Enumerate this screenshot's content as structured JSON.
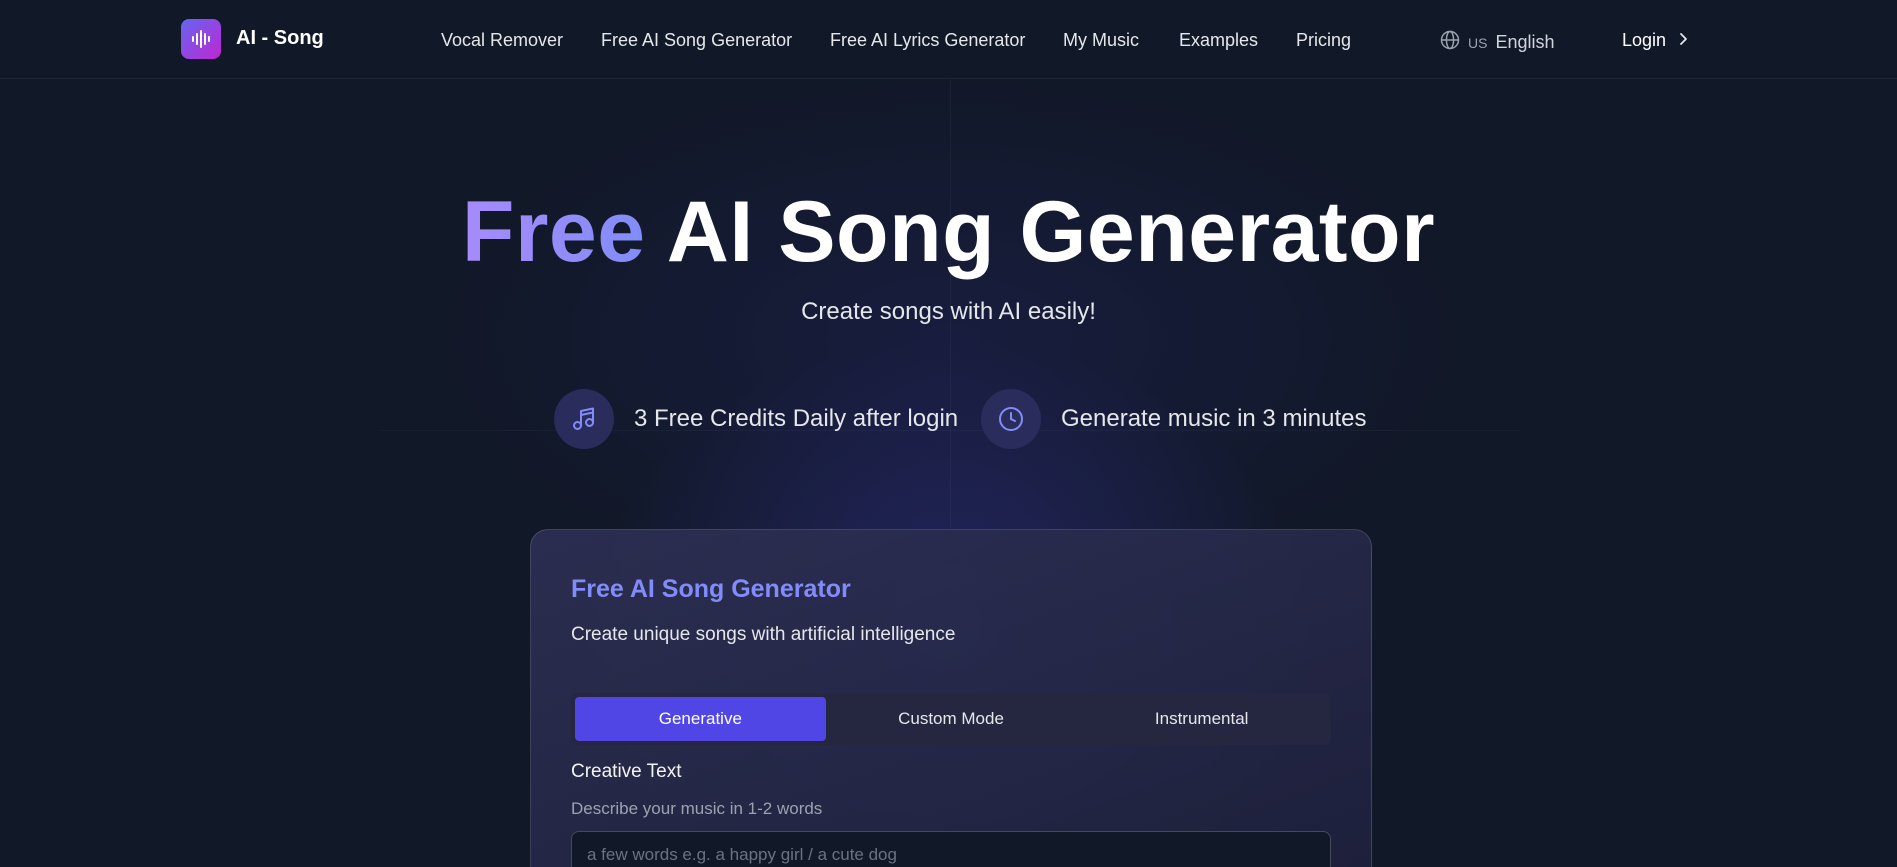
{
  "brand": {
    "name": "AI - Song"
  },
  "nav": {
    "items": [
      {
        "label": "Vocal Remover"
      },
      {
        "label": "Free AI Song Generator"
      },
      {
        "label": "Free AI Lyrics Generator"
      },
      {
        "label": "My Music"
      },
      {
        "label": "Examples"
      },
      {
        "label": "Pricing"
      }
    ],
    "language_flag": "US",
    "language": "English",
    "login": "Login"
  },
  "hero": {
    "title_accent": "Free",
    "title_rest": "AI Song Generator",
    "subtitle": "Create songs with AI easily!",
    "features": [
      {
        "icon": "music-note-icon",
        "text": "3 Free Credits Daily after login"
      },
      {
        "icon": "clock-icon",
        "text": "Generate music in 3 minutes"
      }
    ]
  },
  "card": {
    "title": "Free AI Song Generator",
    "subtitle": "Create unique songs with artificial intelligence",
    "tabs": [
      {
        "label": "Generative",
        "active": true
      },
      {
        "label": "Custom Mode",
        "active": false
      },
      {
        "label": "Instrumental",
        "active": false
      }
    ],
    "field_label": "Creative Text",
    "field_hint": "Describe your music in 1-2 words",
    "input_placeholder": "a few words e.g. a happy girl / a cute dog",
    "input_value": ""
  },
  "colors": {
    "background": "#111827",
    "accent": "#818cf8",
    "active_tab": "#4f46e5",
    "logo_gradient": [
      "#6366f1",
      "#c026d3"
    ]
  }
}
